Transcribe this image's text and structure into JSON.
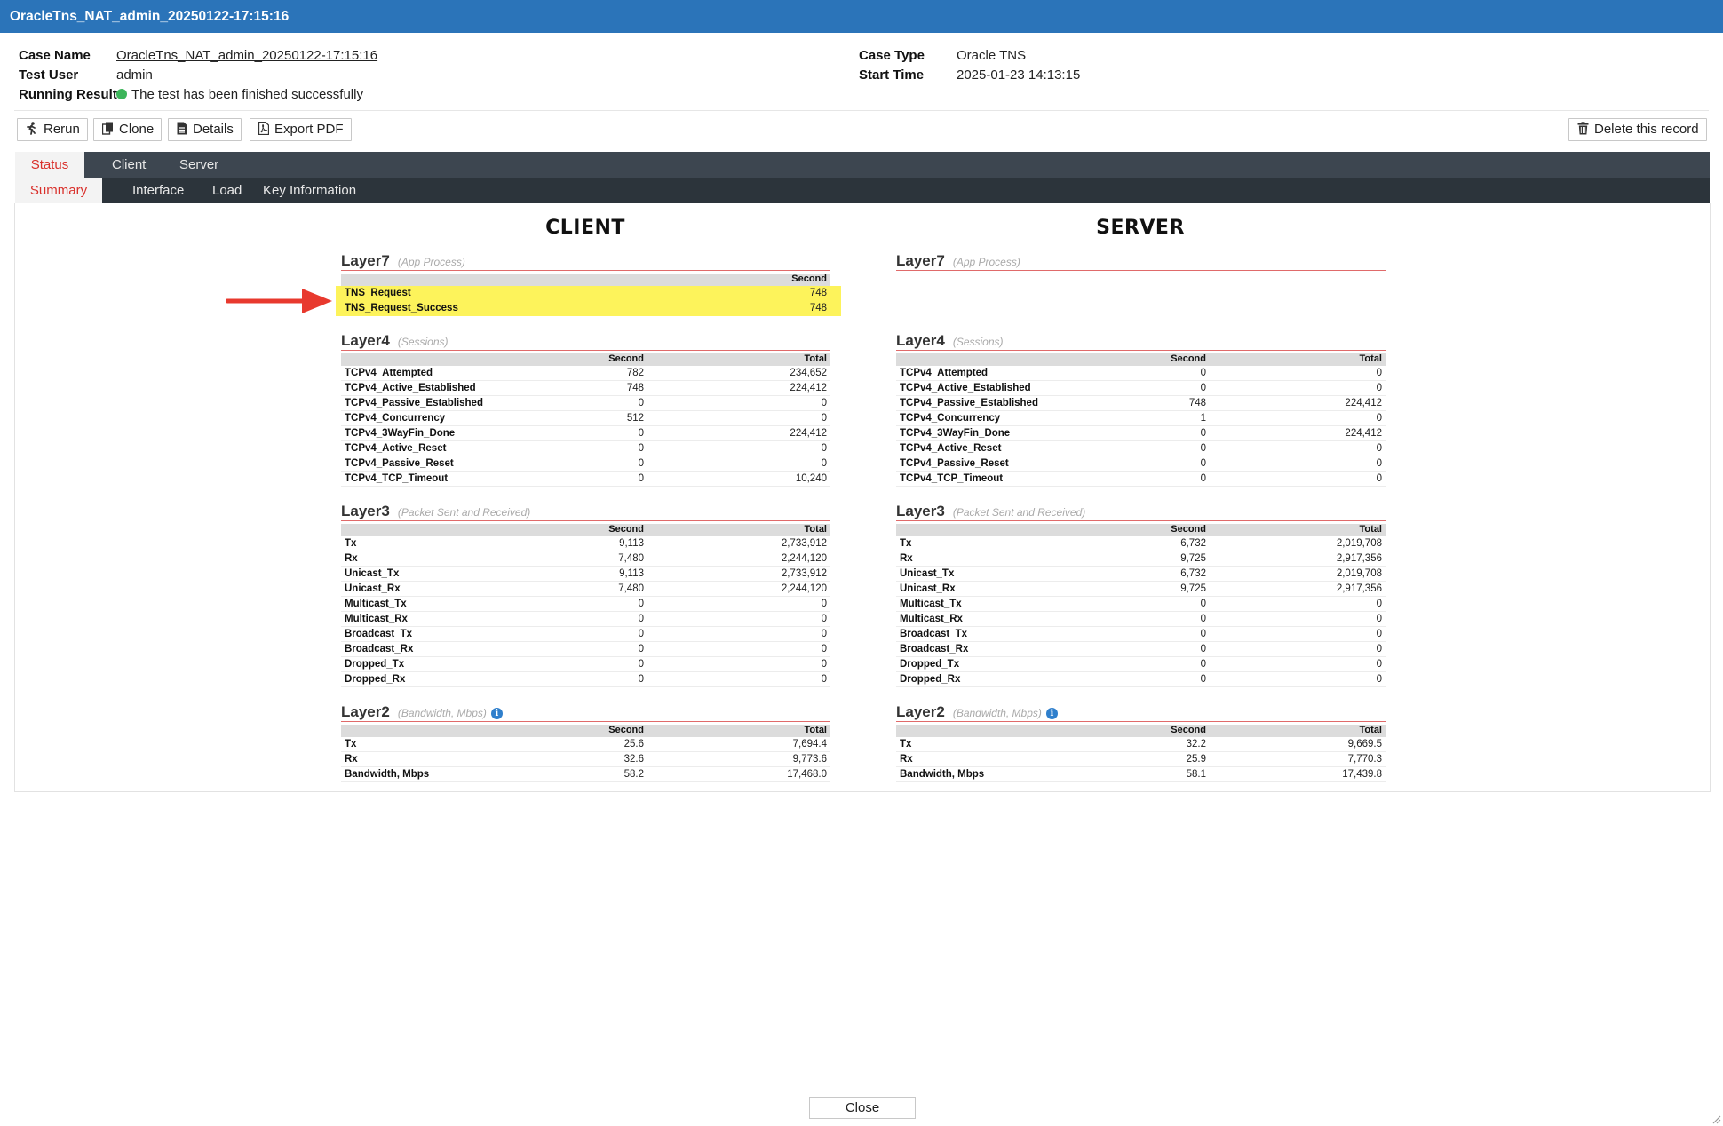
{
  "window": {
    "title": "OracleTns_NAT_admin_20250122-17:15:16"
  },
  "info": {
    "case_name_label": "Case Name",
    "case_name": "OracleTns_NAT_admin_20250122-17:15:16",
    "test_user_label": "Test User",
    "test_user": "admin",
    "running_result_label": "Running Result",
    "running_result": "The test has been finished successfully",
    "running_result_color": "#3cb55a",
    "case_type_label": "Case Type",
    "case_type": "Oracle TNS",
    "start_time_label": "Start Time",
    "start_time": "2025-01-23 14:13:15"
  },
  "toolbar": {
    "rerun": "Rerun",
    "rerun_icon": "run-icon",
    "clone": "Clone",
    "clone_icon": "copy-icon",
    "details": "Details",
    "details_icon": "document-icon",
    "export_pdf": "Export PDF",
    "export_pdf_icon": "pdf-icon",
    "delete": "Delete this record",
    "delete_icon": "trash-icon"
  },
  "tabs": {
    "primary": [
      "Status",
      "Client",
      "Server"
    ],
    "secondary": [
      "Summary",
      "Interface",
      "Load",
      "Key Information"
    ],
    "active_primary": "Status",
    "active_secondary": "Summary",
    "active_color": "#d9302b"
  },
  "client": {
    "heading": "CLIENT",
    "layer7": {
      "title": "Layer7",
      "subtitle": "(App Process)",
      "columns": [
        "Second"
      ],
      "rows": [
        {
          "name": "TNS_Request",
          "values": [
            "748"
          ],
          "highlight": true
        },
        {
          "name": "TNS_Request_Success",
          "values": [
            "748"
          ],
          "highlight": true
        }
      ]
    },
    "layer4": {
      "title": "Layer4",
      "subtitle": "(Sessions)",
      "columns": [
        "Second",
        "Total"
      ],
      "rows": [
        {
          "name": "TCPv4_Attempted",
          "values": [
            "782",
            "234,652"
          ]
        },
        {
          "name": "TCPv4_Active_Established",
          "values": [
            "748",
            "224,412"
          ]
        },
        {
          "name": "TCPv4_Passive_Established",
          "values": [
            "0",
            "0"
          ]
        },
        {
          "name": "TCPv4_Concurrency",
          "values": [
            "512",
            "0"
          ]
        },
        {
          "name": "TCPv4_3WayFin_Done",
          "values": [
            "0",
            "224,412"
          ]
        },
        {
          "name": "TCPv4_Active_Reset",
          "values": [
            "0",
            "0"
          ]
        },
        {
          "name": "TCPv4_Passive_Reset",
          "values": [
            "0",
            "0"
          ]
        },
        {
          "name": "TCPv4_TCP_Timeout",
          "values": [
            "0",
            "10,240"
          ]
        }
      ]
    },
    "layer3": {
      "title": "Layer3",
      "subtitle": "(Packet Sent and Received)",
      "columns": [
        "Second",
        "Total"
      ],
      "rows": [
        {
          "name": "Tx",
          "values": [
            "9,113",
            "2,733,912"
          ]
        },
        {
          "name": "Rx",
          "values": [
            "7,480",
            "2,244,120"
          ]
        },
        {
          "name": "Unicast_Tx",
          "values": [
            "9,113",
            "2,733,912"
          ]
        },
        {
          "name": "Unicast_Rx",
          "values": [
            "7,480",
            "2,244,120"
          ]
        },
        {
          "name": "Multicast_Tx",
          "values": [
            "0",
            "0"
          ]
        },
        {
          "name": "Multicast_Rx",
          "values": [
            "0",
            "0"
          ]
        },
        {
          "name": "Broadcast_Tx",
          "values": [
            "0",
            "0"
          ]
        },
        {
          "name": "Broadcast_Rx",
          "values": [
            "0",
            "0"
          ]
        },
        {
          "name": "Dropped_Tx",
          "values": [
            "0",
            "0"
          ]
        },
        {
          "name": "Dropped_Rx",
          "values": [
            "0",
            "0"
          ]
        }
      ]
    },
    "layer2": {
      "title": "Layer2",
      "subtitle": "(Bandwidth, Mbps)",
      "columns": [
        "Second",
        "Total"
      ],
      "rows": [
        {
          "name": "Tx",
          "values": [
            "25.6",
            "7,694.4"
          ]
        },
        {
          "name": "Rx",
          "values": [
            "32.6",
            "9,773.6"
          ]
        },
        {
          "name": "Bandwidth, Mbps",
          "values": [
            "58.2",
            "17,468.0"
          ]
        }
      ]
    }
  },
  "server": {
    "heading": "SERVER",
    "layer7": {
      "title": "Layer7",
      "subtitle": "(App Process)",
      "columns": [],
      "rows": []
    },
    "layer4": {
      "title": "Layer4",
      "subtitle": "(Sessions)",
      "columns": [
        "Second",
        "Total"
      ],
      "rows": [
        {
          "name": "TCPv4_Attempted",
          "values": [
            "0",
            "0"
          ]
        },
        {
          "name": "TCPv4_Active_Established",
          "values": [
            "0",
            "0"
          ]
        },
        {
          "name": "TCPv4_Passive_Established",
          "values": [
            "748",
            "224,412"
          ]
        },
        {
          "name": "TCPv4_Concurrency",
          "values": [
            "1",
            "0"
          ]
        },
        {
          "name": "TCPv4_3WayFin_Done",
          "values": [
            "0",
            "224,412"
          ]
        },
        {
          "name": "TCPv4_Active_Reset",
          "values": [
            "0",
            "0"
          ]
        },
        {
          "name": "TCPv4_Passive_Reset",
          "values": [
            "0",
            "0"
          ]
        },
        {
          "name": "TCPv4_TCP_Timeout",
          "values": [
            "0",
            "0"
          ]
        }
      ]
    },
    "layer3": {
      "title": "Layer3",
      "subtitle": "(Packet Sent and Received)",
      "columns": [
        "Second",
        "Total"
      ],
      "rows": [
        {
          "name": "Tx",
          "values": [
            "6,732",
            "2,019,708"
          ]
        },
        {
          "name": "Rx",
          "values": [
            "9,725",
            "2,917,356"
          ]
        },
        {
          "name": "Unicast_Tx",
          "values": [
            "6,732",
            "2,019,708"
          ]
        },
        {
          "name": "Unicast_Rx",
          "values": [
            "9,725",
            "2,917,356"
          ]
        },
        {
          "name": "Multicast_Tx",
          "values": [
            "0",
            "0"
          ]
        },
        {
          "name": "Multicast_Rx",
          "values": [
            "0",
            "0"
          ]
        },
        {
          "name": "Broadcast_Tx",
          "values": [
            "0",
            "0"
          ]
        },
        {
          "name": "Broadcast_Rx",
          "values": [
            "0",
            "0"
          ]
        },
        {
          "name": "Dropped_Tx",
          "values": [
            "0",
            "0"
          ]
        },
        {
          "name": "Dropped_Rx",
          "values": [
            "0",
            "0"
          ]
        }
      ]
    },
    "layer2": {
      "title": "Layer2",
      "subtitle": "(Bandwidth, Mbps)",
      "columns": [
        "Second",
        "Total"
      ],
      "rows": [
        {
          "name": "Tx",
          "values": [
            "32.2",
            "9,669.5"
          ]
        },
        {
          "name": "Rx",
          "values": [
            "25.9",
            "7,770.3"
          ]
        },
        {
          "name": "Bandwidth, Mbps",
          "values": [
            "58.1",
            "17,439.8"
          ]
        }
      ]
    }
  },
  "highlight_color": "#fdf35b",
  "annotation": {
    "arrow_color": "#e8392e",
    "arrow_icon": "arrow-right-icon"
  },
  "footer": {
    "close": "Close"
  }
}
